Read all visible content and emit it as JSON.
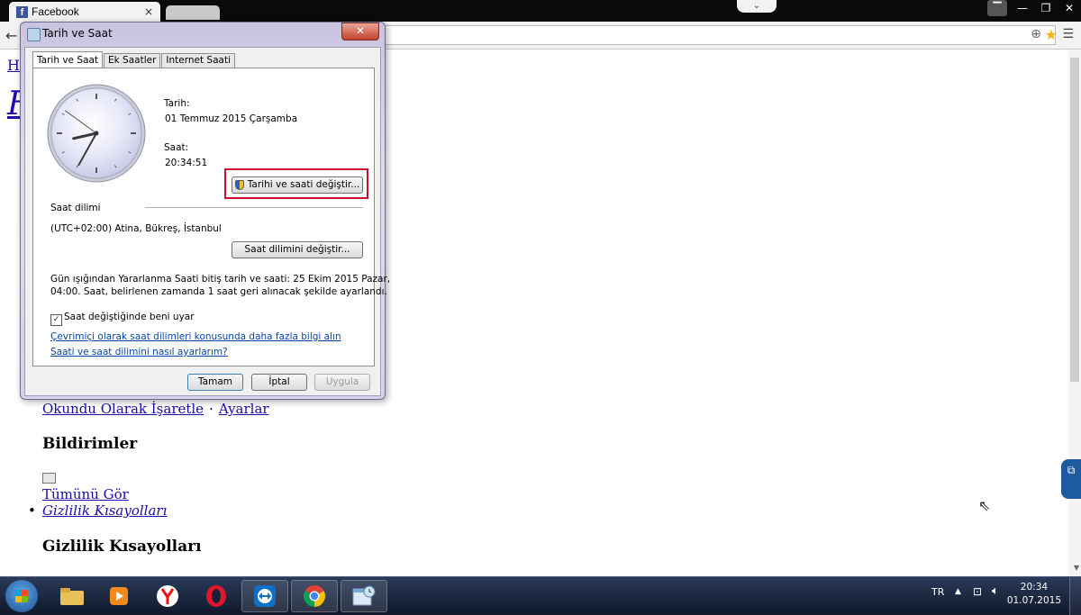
{
  "browser": {
    "tab_title": "Facebook",
    "tab_close": "×",
    "favicon": "f"
  },
  "page": {
    "fragment_top": "Ha",
    "fragment_big": "F",
    "mark_read": "Okundu Olarak İşaretle",
    "separator": "·",
    "settings": "Ayarlar",
    "notifications_heading": "Bildirimler",
    "see_all": "Tümünü Gör",
    "privacy_link": "Gizlilik Kısayolları",
    "privacy_heading": "Gizlilik Kısayolları"
  },
  "dialog": {
    "title": "Tarih ve Saat",
    "tabs": [
      "Tarih ve Saat",
      "Ek Saatler",
      "Internet Saati"
    ],
    "date_label": "Tarih:",
    "date_value": "01 Temmuz 2015 Çarşamba",
    "time_label": "Saat:",
    "time_value": "20:34:51",
    "change_datetime_button": "Tarihi ve saati değiştir...",
    "timezone_label": "Saat dilimi",
    "timezone_value": "(UTC+02:00) Atina, Bükreş, İstanbul",
    "change_timezone_button": "Saat dilimini değiştir...",
    "dst_line1": "Gün ışığından Yararlanma Saati bitiş tarih ve saati: 25 Ekim 2015 Pazar,",
    "dst_line2": "04:00. Saat, belirlenen zamanda 1 saat geri alınacak şekilde ayarlandı.",
    "notify_checkbox_label": "Saat değiştiğinde beni uyar",
    "notify_checked": true,
    "link_online_tz": "Çevrimiçi olarak saat dilimleri konusunda daha fazla bilgi alın",
    "link_howto": "Saati ve saat dilimini nasıl ayarlarım?",
    "ok_button": "Tamam",
    "cancel_button": "İptal",
    "apply_button": "Uygula",
    "analog_time": {
      "hour": 20,
      "minute": 34,
      "second": 51
    }
  },
  "taskbar": {
    "language": "TR",
    "time": "20:34",
    "date": "01.07.2015"
  },
  "colors": {
    "highlight_border": "#c8102e",
    "link": "#0645ad",
    "page_link": "#1a0dab"
  }
}
